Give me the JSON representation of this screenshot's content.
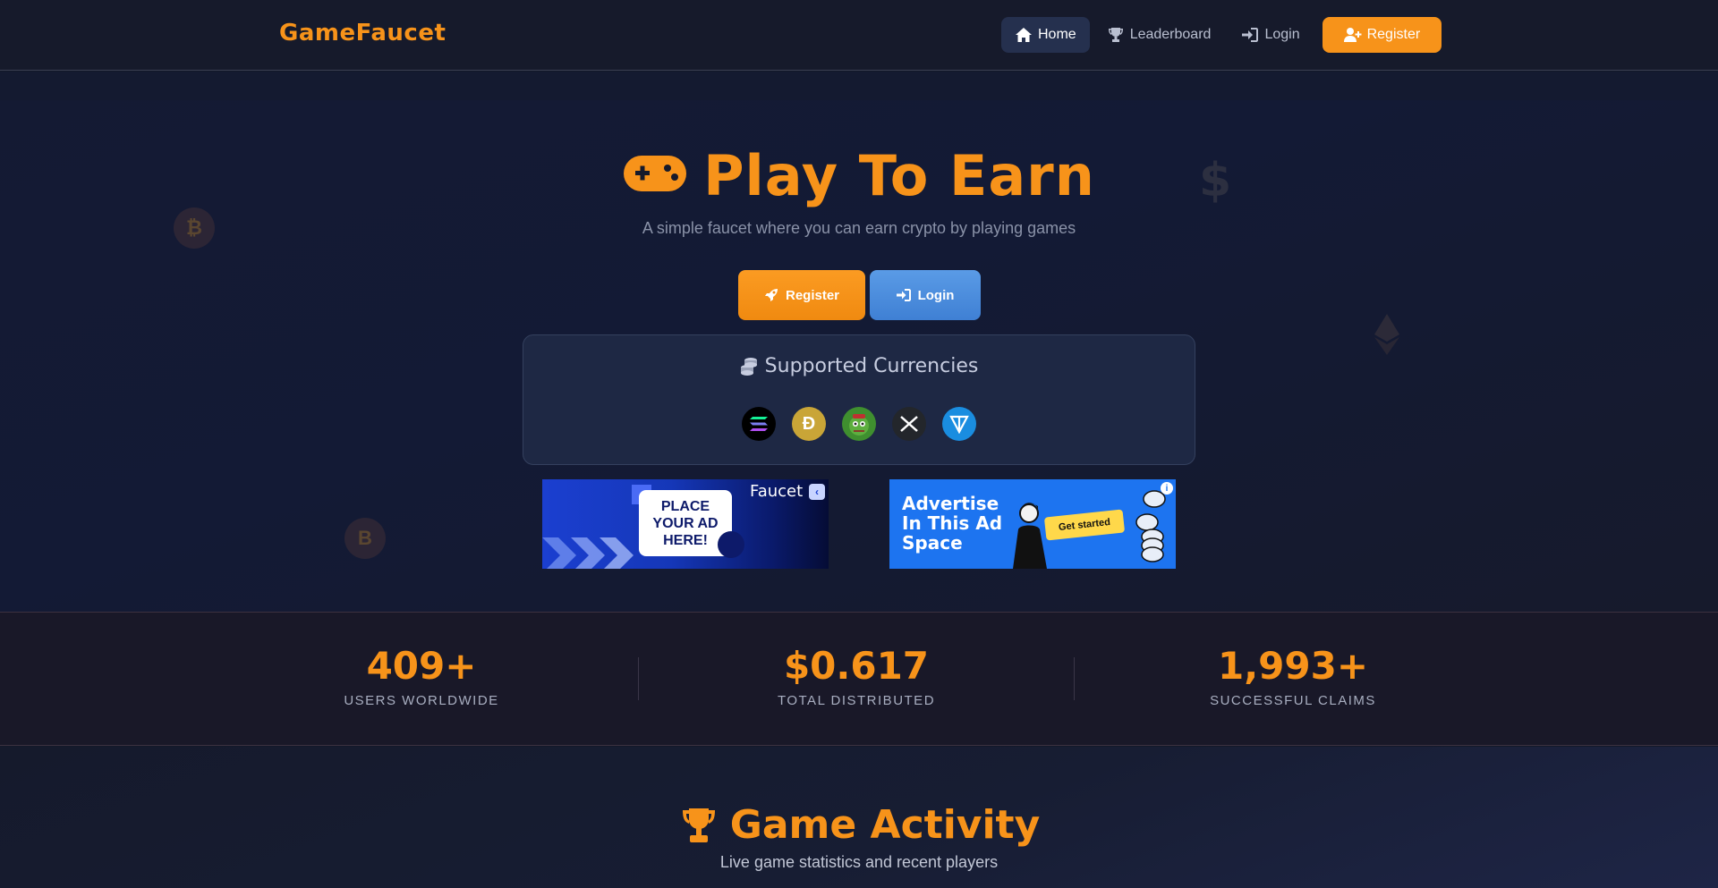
{
  "nav": {
    "brand": "GameFaucet",
    "home": "Home",
    "leaderboard": "Leaderboard",
    "login": "Login",
    "register": "Register",
    "icons": [
      "home-icon",
      "trophy-icon",
      "sign-in-icon",
      "user-plus-icon"
    ]
  },
  "hero": {
    "title": "Play To Earn",
    "subtitle": "A simple faucet where you can earn crypto by playing games",
    "register_button": "Register",
    "login_button": "Login",
    "currencies_title": "Supported Currencies",
    "coins": [
      {
        "name": "solana-icon",
        "color": "#000000"
      },
      {
        "name": "dogecoin-icon",
        "color": "#c9a537",
        "symbol": "Ð"
      },
      {
        "name": "pepe-icon",
        "color": "#3f8f2f"
      },
      {
        "name": "xrp-icon",
        "color": "#23262b"
      },
      {
        "name": "ton-icon",
        "color": "#1a8de0"
      }
    ],
    "deco_coins": [
      "$",
      "₿",
      "B"
    ]
  },
  "ads": {
    "left": {
      "card_text": "PLACE YOUR AD HERE!",
      "brand_text": "Faucet"
    },
    "right": {
      "headline": "Advertise In This Ad Space",
      "cta": "Get started"
    }
  },
  "stats": [
    {
      "value": "409+",
      "label": "USERS WORLDWIDE"
    },
    {
      "value": "$0.617",
      "label": "TOTAL DISTRIBUTED"
    },
    {
      "value": "1,993+",
      "label": "SUCCESSFUL CLAIMS"
    }
  ],
  "activity": {
    "title": "Game Activity",
    "subtitle": "Live game statistics and recent players"
  },
  "colors": {
    "accent": "#f7931a",
    "login_blue": "#4a8cdb",
    "background": "#131829"
  }
}
